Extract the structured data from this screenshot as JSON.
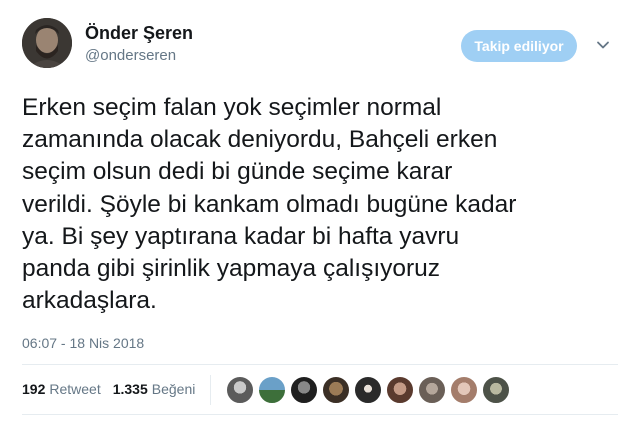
{
  "author": {
    "name": "Önder Şeren",
    "handle": "@onderseren"
  },
  "follow_button": {
    "label": "Takip ediliyor",
    "color": "#9fcff4"
  },
  "tweet": {
    "lines": [
      "Erken seçim falan yok seçimler normal",
      "zamanında olacak deniyordu, Bahçeli erken",
      "seçim olsun dedi bi günde seçime karar",
      "verildi. Şöyle bi kankam olmadı bugüne kadar",
      "ya. Bi şey yaptırana kadar bi hafta yavru",
      "panda gibi şirinlik yapmaya çalışıyoruz",
      "arkadaşlara."
    ],
    "timestamp": "06:07 - 18 Nis 2018"
  },
  "stats": {
    "retweets_count": "192",
    "retweets_label": "Retweet",
    "likes_count": "1.335",
    "likes_label": "Beğeni"
  },
  "icons": {
    "dropdown": "chevron-down-icon",
    "avatar": "avatar",
    "liker_avatars": 9
  }
}
